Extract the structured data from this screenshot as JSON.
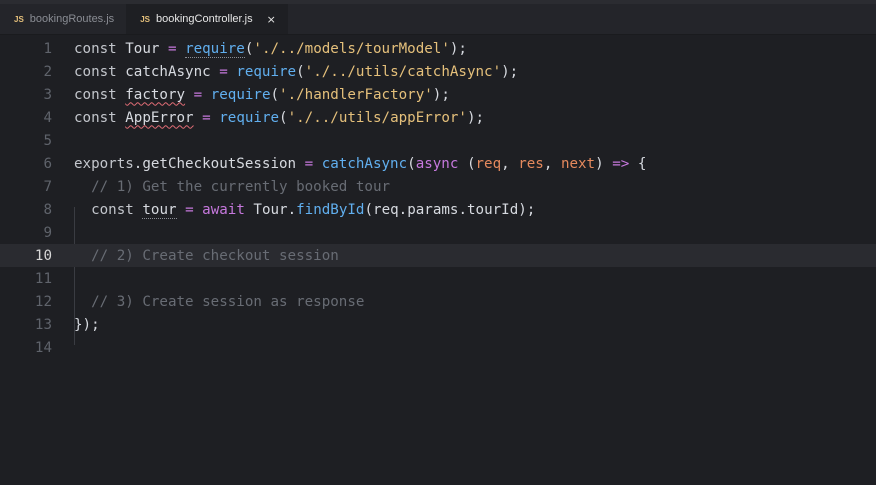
{
  "tabs": [
    {
      "icon": "JS",
      "label": "bookingRoutes.js"
    },
    {
      "icon": "JS",
      "label": "bookingController.js",
      "close": "×"
    }
  ],
  "code": {
    "line_numbers": [
      "1",
      "2",
      "3",
      "4",
      "5",
      "6",
      "7",
      "8",
      "9",
      "10",
      "11",
      "12",
      "13",
      "14"
    ],
    "l1": {
      "kw": "const",
      "name": " Tour ",
      "eq": "=",
      "sp": " ",
      "fn": "require",
      "open": "(",
      "str": "'./../models/tourModel'",
      "close": ");"
    },
    "l2": {
      "kw": "const",
      "name": " catchAsync ",
      "eq": "=",
      "sp": " ",
      "fn": "require",
      "open": "(",
      "str": "'./../utils/catchAsync'",
      "close": ");"
    },
    "l3": {
      "kw": "const",
      "sp1": " ",
      "name": "factory",
      "sp2": " ",
      "eq": "=",
      "sp": " ",
      "fn": "require",
      "open": "(",
      "str": "'./handlerFactory'",
      "close": ");"
    },
    "l4": {
      "kw": "const",
      "sp1": " ",
      "name": "AppError",
      "sp2": " ",
      "eq": "=",
      "sp": " ",
      "fn": "require",
      "open": "(",
      "str": "'./../utils/appError'",
      "close": ");"
    },
    "l6": {
      "obj": "exports",
      "dot": ".",
      "prop": "getCheckoutSession",
      "eq": " = ",
      "fn": "catchAsync",
      "open": "(",
      "async": "async",
      "p_open": " (",
      "p1": "req",
      "c1": ", ",
      "p2": "res",
      "c2": ", ",
      "p3": "next",
      "p_close": ")",
      "arrow": " => ",
      "brace": "{"
    },
    "l7": {
      "indent": "  ",
      "comment": "// 1) Get the currently booked tour"
    },
    "l8": {
      "indent": "  ",
      "kw": "const",
      "sp1": " ",
      "name": "tour",
      "eq": " = ",
      "await": "await",
      "obj": " Tour",
      "dot": ".",
      "fn": "findById",
      "rest": "(req.params.tourId);"
    },
    "l10": {
      "indent": "  ",
      "comment": "// 2) Create checkout session"
    },
    "l12": {
      "indent": "  ",
      "comment": "// 3) Create session as response"
    },
    "l13": {
      "brace": "}",
      "rest": ");"
    }
  }
}
